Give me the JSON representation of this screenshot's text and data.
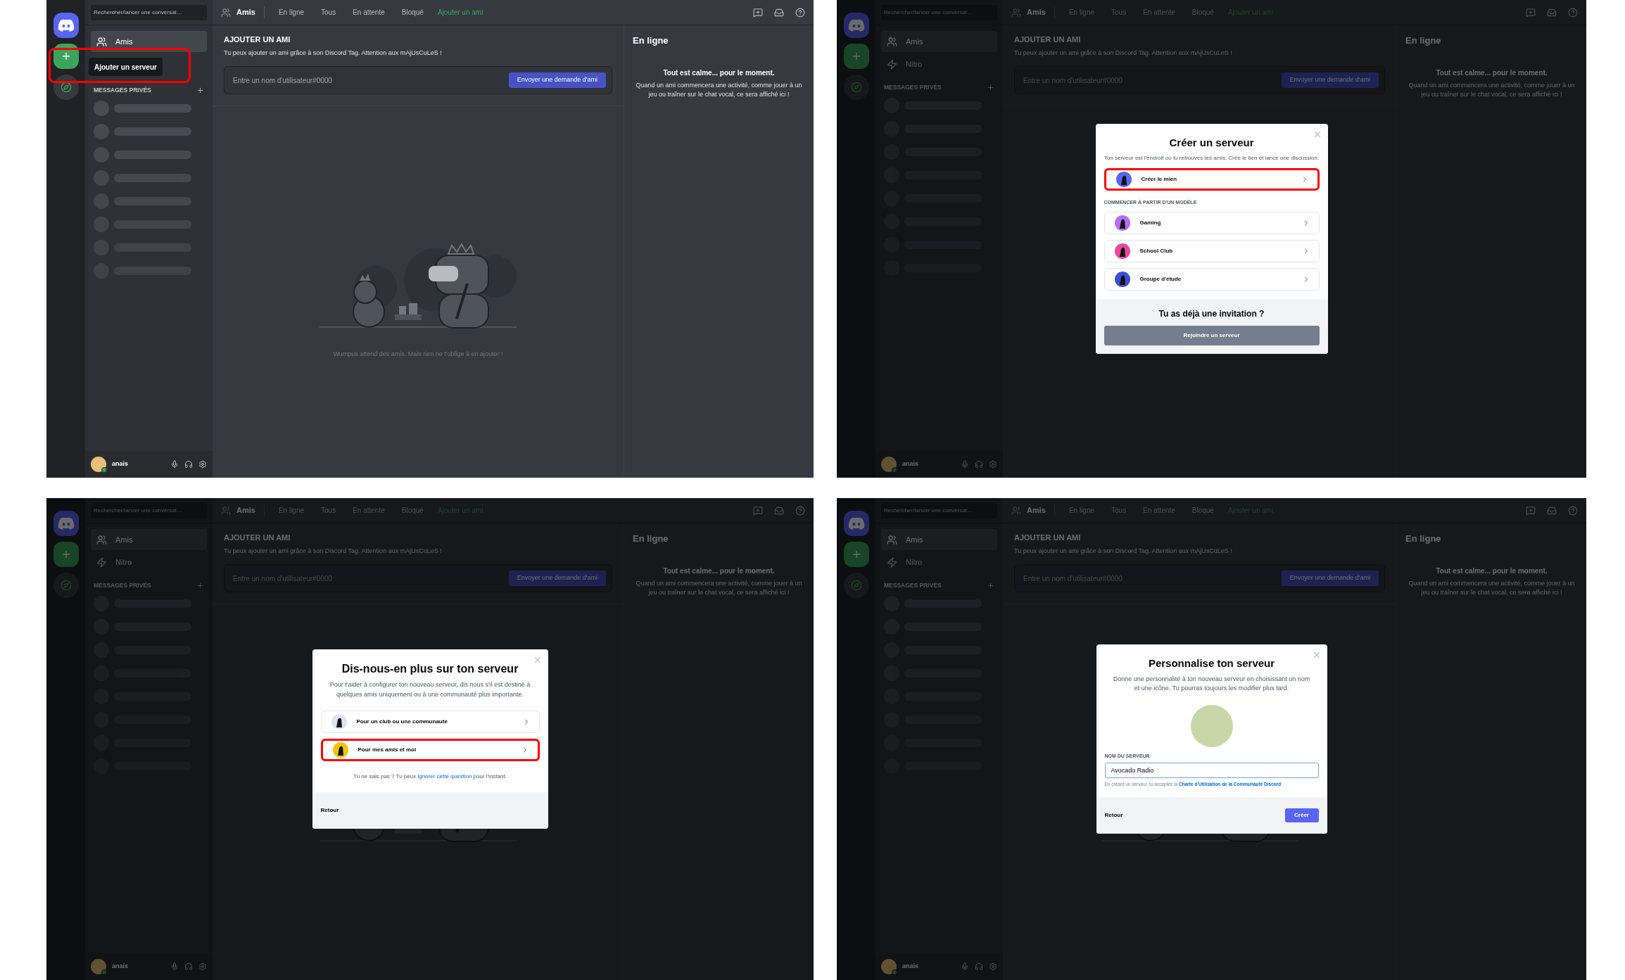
{
  "panels": [
    {
      "dimmed": false,
      "app": {
        "search": {
          "placeholder": "Rechercher/lancer une conversat…"
        },
        "sidebar": {
          "items": [
            {
              "label": "Amis",
              "kind": "friends",
              "selected": true
            }
          ],
          "section": "MESSAGES PRIVÉS"
        },
        "user": {
          "name": "anais"
        },
        "header": {
          "title": "Amis",
          "tabs": [
            {
              "label": "En ligne",
              "selected": false
            },
            {
              "label": "Tous",
              "selected": false
            },
            {
              "label": "En attente",
              "selected": false
            },
            {
              "label": "Bloqué",
              "selected": false
            }
          ],
          "add_tab": "Ajouter un ami"
        },
        "add_friend": {
          "title": "AJOUTER UN AMI",
          "description": "Tu peux ajouter un ami grâce à son Discord Tag. Attention aux mAjUsCuLeS !",
          "placeholder": "Entre un nom d'utilisateur#0000",
          "button": "Envoyer une demande d'ami"
        },
        "empty_text": "Wumpus attend des amis. Mais rien ne t'oblige à en ajouter !",
        "right": {
          "title": "En ligne",
          "heading": "Tout est calme... pour le moment.",
          "text": "Quand un ami commencera une activité, comme jouer à un jeu ou traîner sur le chat vocal, ce sera affiché ici !"
        }
      },
      "tooltip": {
        "text": "Ajouter un serveur",
        "highlighted": true
      }
    },
    {
      "dimmed": true,
      "app": {
        "search": {
          "placeholder": "Rechercher/lancer une conversat…"
        },
        "sidebar": {
          "items": [
            {
              "label": "Amis",
              "kind": "friends",
              "selected": true
            },
            {
              "label": "Nitro",
              "kind": "nitro",
              "selected": false
            }
          ],
          "section": "MESSAGES PRIVÉS"
        },
        "user": {
          "name": "anais"
        },
        "header": {
          "title": "Amis",
          "tabs": [
            {
              "label": "En ligne",
              "selected": false
            },
            {
              "label": "Tous",
              "selected": false
            },
            {
              "label": "En attente",
              "selected": false
            },
            {
              "label": "Bloqué",
              "selected": false
            }
          ],
          "add_tab": "Ajouter un ami"
        },
        "add_friend": {
          "title": "AJOUTER UN AMI",
          "description": "Tu peux ajouter un ami grâce à son Discord Tag. Attention aux mAjUsCuLeS !",
          "placeholder": "Entre un nom d'utilisateur#0000",
          "button": "Envoyer une demande d'ami"
        },
        "right": {
          "title": "En ligne",
          "heading": "Tout est calme... pour le moment.",
          "text": "Quand un ami commencera une activité, comme jouer à un jeu ou traîner sur le chat vocal, ce sera affiché ici !"
        }
      },
      "modal": {
        "kind": "create",
        "title": "Créer un serveur",
        "description": "Ton serveur est l'endroit où tu retrouves tes amis. Crée le tien et lance une discussion.",
        "options": [
          {
            "label": "Créer le mien",
            "highlighted": true
          }
        ],
        "section": "COMMENCER À PARTIR D'UN MODÈLE",
        "templates": [
          {
            "label": "Gaming",
            "highlighted": false
          },
          {
            "label": "School Club",
            "highlighted": false
          },
          {
            "label": "Groupe d'étude",
            "highlighted": false
          }
        ],
        "footer_title": "Tu as déjà une invitation ?",
        "footer_button": "Rejoindre un serveur"
      }
    },
    {
      "dimmed": true,
      "app": {
        "search": {
          "placeholder": "Rechercher/lancer une conversat…"
        },
        "sidebar": {
          "items": [
            {
              "label": "Amis",
              "kind": "friends",
              "selected": true
            },
            {
              "label": "Nitro",
              "kind": "nitro",
              "selected": false
            }
          ],
          "section": "MESSAGES PRIVÉS"
        },
        "user": {
          "name": "anais"
        },
        "header": {
          "title": "Amis",
          "tabs": [
            {
              "label": "En ligne",
              "selected": false
            },
            {
              "label": "Tous",
              "selected": false
            },
            {
              "label": "En attente",
              "selected": false
            },
            {
              "label": "Bloqué",
              "selected": false
            }
          ],
          "add_tab": "Ajouter un ami"
        },
        "add_friend": {
          "title": "AJOUTER UN AMI",
          "description": "Tu peux ajouter un ami grâce à son Discord Tag. Attention aux mAjUsCuLeS !",
          "placeholder": "Entre un nom d'utilisateur#0000",
          "button": "Envoyer une demande d'ami"
        },
        "right": {
          "title": "En ligne",
          "heading": "Tout est calme... pour le moment.",
          "text": "Quand un ami commencera une activité, comme jouer à un jeu ou traîner sur le chat vocal, ce sera affiché ici !"
        }
      },
      "modal": {
        "kind": "about",
        "title": "Dis-nous-en plus sur ton serveur",
        "description": "Pour t'aider à configurer ton nouveau serveur, dis nous s'il est destiné à quelques amis uniquement ou à une communauté plus importante.",
        "options": [
          {
            "label": "Pour un club ou une communauté",
            "highlighted": false
          },
          {
            "label": "Pour mes amis et moi",
            "highlighted": true
          }
        ],
        "hint_before": "Tu ne sais pas ? Tu peux ",
        "hint_link": "ignorer cette question",
        "hint_after": " pour l'instant.",
        "back": "Retour"
      }
    },
    {
      "dimmed": true,
      "app": {
        "search": {
          "placeholder": "Rechercher/lancer une conversat…"
        },
        "sidebar": {
          "items": [
            {
              "label": "Amis",
              "kind": "friends",
              "selected": true
            },
            {
              "label": "Nitro",
              "kind": "nitro",
              "selected": false
            }
          ],
          "section": "MESSAGES PRIVÉS"
        },
        "user": {
          "name": "anais"
        },
        "header": {
          "title": "Amis",
          "tabs": [
            {
              "label": "En ligne",
              "selected": false
            },
            {
              "label": "Tous",
              "selected": false
            },
            {
              "label": "En attente",
              "selected": false
            },
            {
              "label": "Bloqué",
              "selected": false
            }
          ],
          "add_tab": "Ajouter un ami"
        },
        "add_friend": {
          "title": "AJOUTER UN AMI",
          "description": "Tu peux ajouter un ami grâce à son Discord Tag. Attention aux mAjUsCuLeS !",
          "placeholder": "Entre un nom d'utilisateur#0000",
          "button": "Envoyer une demande d'ami"
        },
        "right": {
          "title": "En ligne",
          "heading": "Tout est calme... pour le moment.",
          "text": "Quand un ami commencera une activité, comme jouer à un jeu ou traîner sur le chat vocal, ce sera affiché ici !"
        }
      },
      "modal": {
        "kind": "customize",
        "title": "Personnalise ton serveur",
        "description": "Donne une personnalité à ton nouveau serveur en choisissant un nom et une icône. Tu pourras toujours les modifier plus tard.",
        "field_label": "NOM DU SERVEUR",
        "field_value": "Avocado Radio",
        "legal_before": "En créant un serveur, tu acceptes la ",
        "legal_link": "Charte d'Utilisation de la Communauté Discord",
        "legal_after": ".",
        "back": "Retour",
        "submit": "Créer"
      }
    }
  ]
}
